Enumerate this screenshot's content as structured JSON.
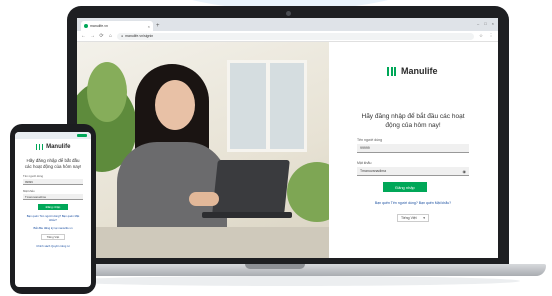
{
  "browser": {
    "tab_title": "manulife.vn",
    "tab_close": "×",
    "new_tab": "+",
    "window_controls": [
      "–",
      "□",
      "×"
    ],
    "nav": [
      "←",
      "→",
      "⟳",
      "⌂"
    ],
    "url": "manulife.vn/signin",
    "extensions": [
      "☆",
      "⋮"
    ]
  },
  "login": {
    "brand_name": "Manulife",
    "headline": "Hãy đăng nhập để bắt đầu các hoạt động của hôm nay!",
    "username_label": "Tên người dùng",
    "username_value": "99999",
    "password_label": "Mật khẩu",
    "password_value": "Tmanuvanadima",
    "login_button": "Đăng nhập",
    "forgot_link": "Bạn quên Tên người dùng? Bạn quên Mật khẩu?",
    "language": "Tiếng Việt"
  },
  "phone": {
    "brand_name": "Manulife",
    "headline": "Hãy đăng nhập để bắt đầu các hoạt động của hôm nay!",
    "username_label": "Tên người dùng",
    "username_value": "99999",
    "password_label": "Mật khẩu",
    "password_value": "Tmanuvanadima",
    "login_button": "Đăng nhập",
    "forgot_link": "Bạn quên Tên người dùng? Bạn quên Mật khẩu?",
    "register_link": "Bắt đầu đăng ký tại manulife.vn",
    "language": "Tiếng Việt",
    "footer_link": "Chính sách Quyền riêng tư"
  },
  "colors": {
    "brand_green": "#00a758",
    "link_blue": "#1a4fa0",
    "device_dark": "#1e1f22"
  }
}
